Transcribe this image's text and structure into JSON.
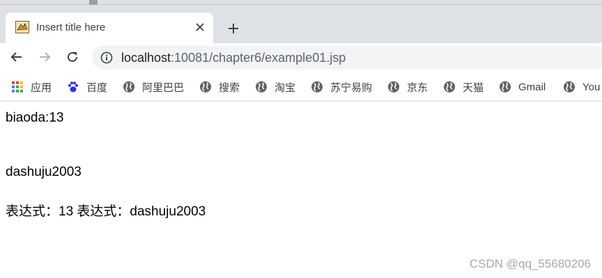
{
  "browser": {
    "tab": {
      "title": "Insert title here"
    },
    "address_bar": {
      "host": "localhost",
      "path": ":10081/chapter6/example01.jsp"
    },
    "bookmarks": [
      {
        "label": "应用",
        "icon": "apps-grid-icon"
      },
      {
        "label": "百度",
        "icon": "baidu-paw-icon"
      },
      {
        "label": "阿里巴巴",
        "icon": "globe-icon"
      },
      {
        "label": "搜索",
        "icon": "globe-icon"
      },
      {
        "label": "淘宝",
        "icon": "globe-icon"
      },
      {
        "label": "苏宁易购",
        "icon": "globe-icon"
      },
      {
        "label": "京东",
        "icon": "globe-icon"
      },
      {
        "label": "天猫",
        "icon": "globe-icon"
      },
      {
        "label": "Gmail",
        "icon": "globe-icon"
      },
      {
        "label": "You",
        "icon": "globe-icon"
      }
    ]
  },
  "page": {
    "line1": "biaoda:13",
    "line2": "dashuju2003",
    "line3": "表达式：13 表达式：dashuju2003"
  },
  "watermark": "CSDN @qq_55680206"
}
